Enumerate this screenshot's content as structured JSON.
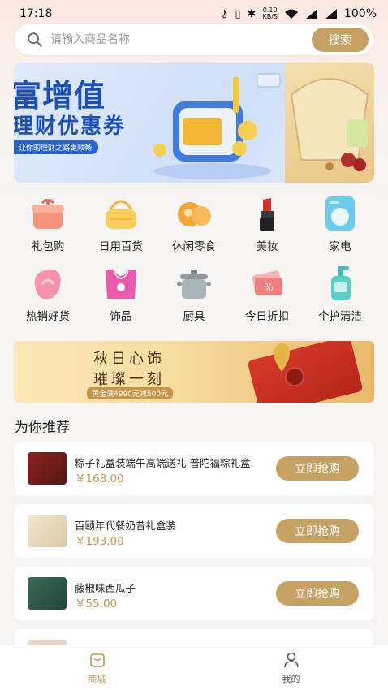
{
  "status_bar": {
    "time": "17:18",
    "net_speed_value": "0.10",
    "net_speed_unit": "KB/S",
    "battery": "100%"
  },
  "search": {
    "placeholder": "请输入商品名称",
    "button_label": "搜索"
  },
  "banner": {
    "title": "富增值",
    "subtitle": "理财优惠券",
    "tagline": "让你的理财之路更顺畅"
  },
  "categories": [
    {
      "label": "礼包购",
      "icon": "gift-box-icon",
      "color": "#f28c6b"
    },
    {
      "label": "日用百货",
      "icon": "basket-icon",
      "color": "#f4c24a"
    },
    {
      "label": "休闲零食",
      "icon": "snack-icon",
      "color": "#f2a23a"
    },
    {
      "label": "美妆",
      "icon": "lipstick-icon",
      "color": "#d9302c"
    },
    {
      "label": "家电",
      "icon": "washing-machine-icon",
      "color": "#5cc3e8"
    },
    {
      "label": "热销好货",
      "icon": "hot-sale-icon",
      "color": "#f48aa3"
    },
    {
      "label": "饰品",
      "icon": "necklace-icon",
      "color": "#e85aa6"
    },
    {
      "label": "厨具",
      "icon": "pot-icon",
      "color": "#9aa5ad"
    },
    {
      "label": "今日折扣",
      "icon": "coupon-icon",
      "color": "#f07a7a"
    },
    {
      "label": "个护清洁",
      "icon": "pump-bottle-icon",
      "color": "#3fbfb8"
    }
  ],
  "promo": {
    "title_line1": "秋日心饰",
    "title_line2": "璀璨一刻",
    "tag": "黄金满4990元减500元"
  },
  "recommend": {
    "section_title": "为你推荐",
    "buy_label": "立即抢购",
    "products": [
      {
        "name": "粽子礼盒装端午高端送礼 普陀福粽礼盒",
        "price": "￥168.00",
        "thumb_color": "#7a1f1f"
      },
      {
        "name": "百颐年代餐奶昔礼盒装",
        "price": "￥193.00",
        "thumb_color": "#e8dcc4"
      },
      {
        "name": "藤椒味西瓜子",
        "price": "￥55.00",
        "thumb_color": "#2f5a48"
      }
    ]
  },
  "bottom_nav": {
    "items": [
      {
        "label": "商城",
        "active": true
      },
      {
        "label": "我的",
        "active": false
      }
    ],
    "active_color": "#c5a263",
    "inactive_color": "#555555"
  },
  "colors": {
    "accent": "#c5a263",
    "price": "#c8964f"
  }
}
